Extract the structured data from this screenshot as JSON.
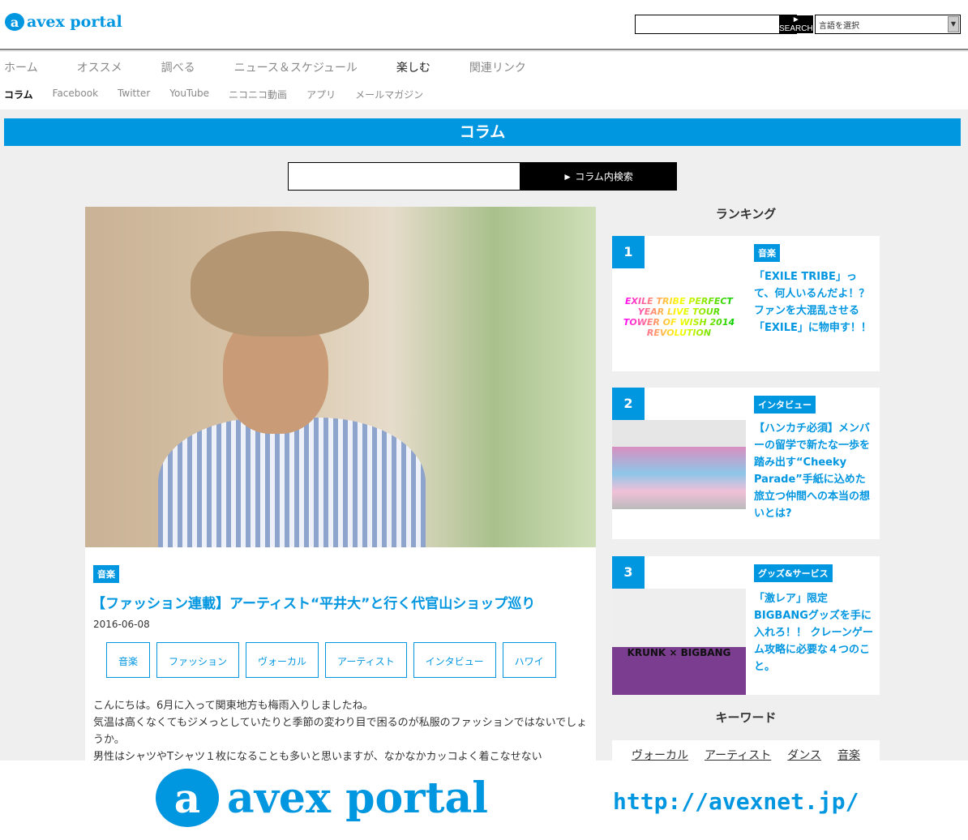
{
  "header": {
    "logo": "avex portal",
    "logo_mark": "a",
    "search_button": "► SEARCH",
    "language_select": "言語を選択"
  },
  "nav": {
    "main": [
      "ホーム",
      "オススメ",
      "調べる",
      "ニュース＆スケジュール",
      "楽しむ",
      "関連リンク"
    ],
    "active_main": "楽しむ",
    "sub": [
      "コラム",
      "Facebook",
      "Twitter",
      "YouTube",
      "ニコニコ動画",
      "アプリ",
      "メールマガジン"
    ]
  },
  "section_title": "コラム",
  "column_search": {
    "button": "► コラム内検索",
    "placeholder": ""
  },
  "article": {
    "category": "音楽",
    "title": "【ファッション連載】アーティスト“平井大”と行く代官山ショップ巡り",
    "date": "2016-06-08",
    "tags": [
      "音楽",
      "ファッション",
      "ヴォーカル",
      "アーティスト",
      "インタビュー",
      "ハワイ"
    ],
    "body": [
      "こんにちは。6月に入って関東地方も梅雨入りしましたね。",
      "気温は高くなくてもジメっとしていたりと季節の変わり目で困るのが私服のファッションではないでしょうか。",
      "男性はシャツやTシャツ１枚になることも多いと思いますが、なかなかカッコよく着こなせない"
    ]
  },
  "ranking": {
    "title": "ランキング",
    "items": [
      {
        "rank": "1",
        "category": "音楽",
        "title": "「EXILE TRIBE」って、何人いるんだよ！？ ファンを大混乱させる「EXILE」に物申す！！",
        "image_text": "EXILE TRIBE PERFECT YEAR LIVE TOUR TOWER OF WISH 2014 REVOLUTION"
      },
      {
        "rank": "2",
        "category": "インタビュー",
        "title": "【ハンカチ必須】メンバーの留学で新たな一歩を踏み出す“Cheeky Parade”手紙に込めた旅立つ仲間への本当の想いとは?"
      },
      {
        "rank": "3",
        "category": "グッズ&サービス",
        "title": "「激レア」限定BIGBANGグッズを手に入れろ！！ クレーンゲーム攻略に必要な４つのこと。",
        "image_text": "KRUNK × BIGBANG"
      }
    ]
  },
  "keywords": {
    "title": "キーワード",
    "items": [
      "ヴォーカル",
      "アーティスト",
      "ダンス",
      "音楽"
    ]
  },
  "footer": {
    "logo": "avex portal",
    "url": "http://avexnet.jp/"
  },
  "colors": {
    "accent": "#0096e0",
    "background": "#efefef"
  }
}
